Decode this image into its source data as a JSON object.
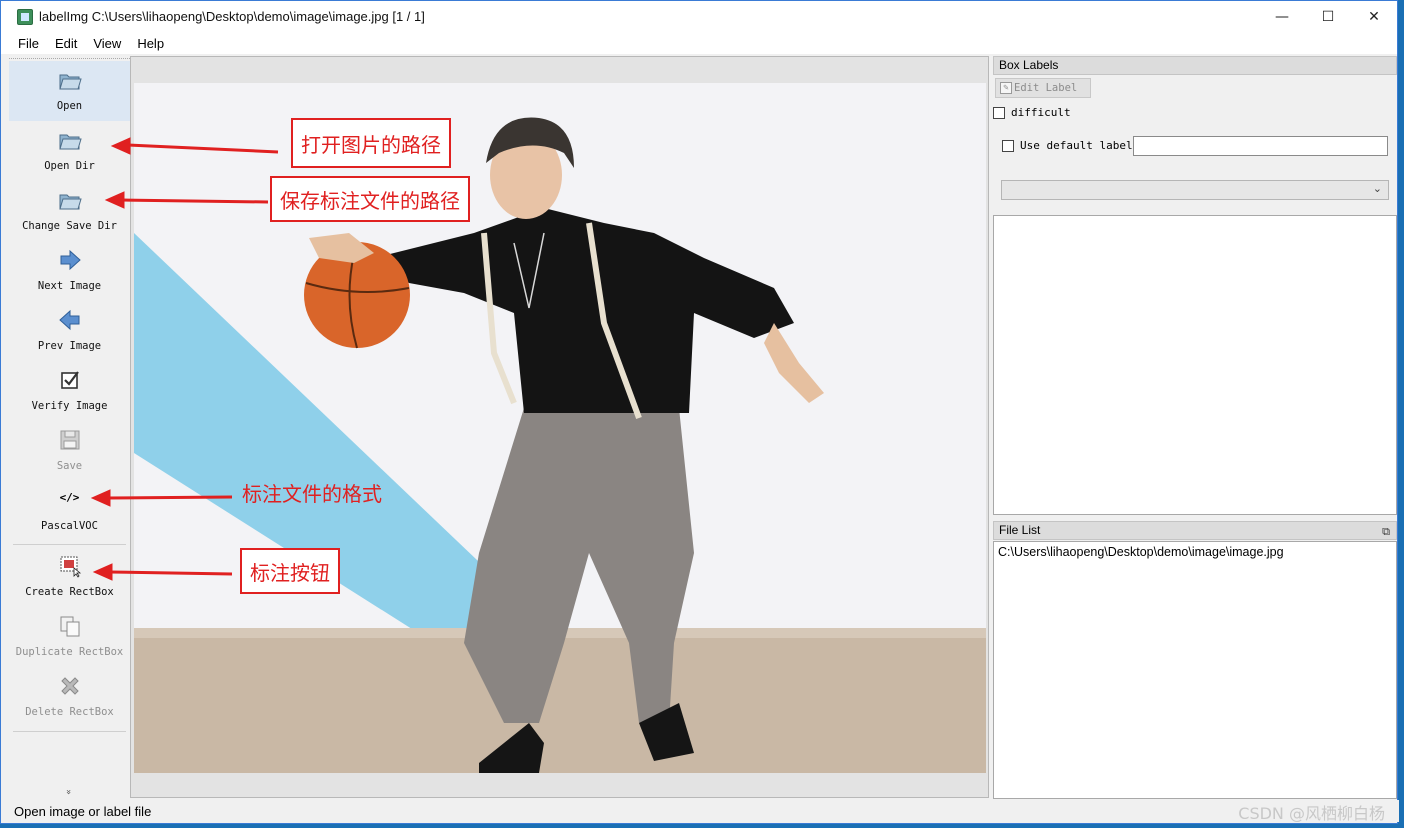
{
  "window": {
    "title": "labelImg C:\\Users\\lihaopeng\\Desktop\\demo\\image\\image.jpg [1 / 1]",
    "controls": {
      "minimize": "—",
      "maximize": "☐",
      "close": "✕"
    }
  },
  "menu": {
    "file": "File",
    "edit": "Edit",
    "view": "View",
    "help": "Help"
  },
  "toolbar": {
    "open": "Open",
    "open_dir": "Open Dir",
    "change_save_dir": "Change Save Dir",
    "next_image": "Next Image",
    "prev_image": "Prev Image",
    "verify_image": "Verify Image",
    "save": "Save",
    "format_glyph": "</>",
    "format": "PascalVOC",
    "create_rectbox": "Create RectBox",
    "duplicate_rectbox": "Duplicate RectBox",
    "delete_rectbox": "Delete RectBox",
    "more": "»"
  },
  "annotations": {
    "open_dir_note": "打开图片的路径",
    "save_dir_note": "保存标注文件的路径",
    "format_note": "标注文件的格式",
    "create_note": "标注按钮"
  },
  "box_labels": {
    "title": "Box Labels",
    "edit_label": "Edit Label",
    "difficult": "difficult",
    "use_default_label": "Use default label",
    "default_label_value": "",
    "combo_value": ""
  },
  "file_list": {
    "title": "File List",
    "items": [
      "C:\\Users\\lihaopeng\\Desktop\\demo\\image\\image.jpg"
    ]
  },
  "status": {
    "text": "Open image or label file",
    "watermark": "CSDN @风栖柳白杨"
  },
  "colors": {
    "annotation_red": "#e02020",
    "sky_stripe": "#8fd0ea",
    "floor": "#c9b8a5",
    "ball": "#d9652a"
  },
  "icons": {
    "open": "folder-icon",
    "open_dir": "folder-icon",
    "change_save_dir": "folder-icon",
    "next_image": "arrow-right-icon",
    "prev_image": "arrow-left-icon",
    "verify_image": "check-box-icon",
    "save": "floppy-icon",
    "create_rectbox": "rect-draw-icon",
    "duplicate_rectbox": "copy-icon",
    "delete_rectbox": "delete-x-icon"
  }
}
